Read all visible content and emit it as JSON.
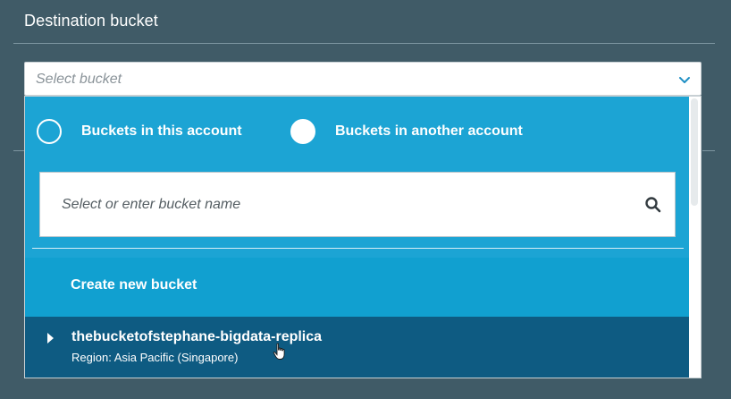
{
  "section": {
    "title": "Destination bucket"
  },
  "select": {
    "placeholder": "Select bucket",
    "chevron_icon": "chevron-down-icon"
  },
  "dropdown": {
    "radios": [
      {
        "label": "Buckets in this account",
        "selected": false
      },
      {
        "label": "Buckets in another account",
        "selected": true
      }
    ],
    "search": {
      "placeholder": "Select or enter bucket name",
      "icon": "search-icon"
    },
    "create_label": "Create new bucket",
    "buckets": [
      {
        "name": "thebucketofstephane-bigdata-replica",
        "region": "Region: Asia Pacific (Singapore)"
      }
    ]
  },
  "colors": {
    "background": "#405b67",
    "dropdown": "#1ca4d4",
    "row_highlight": "#0e5b82",
    "text": "#ffffff"
  }
}
